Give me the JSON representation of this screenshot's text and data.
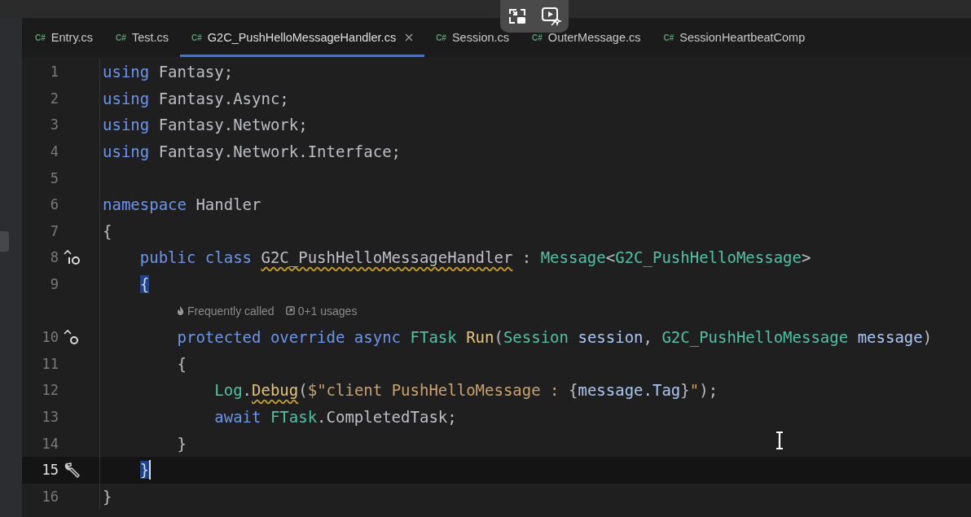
{
  "tabs": [
    {
      "badge": "C#",
      "label": "Entry.cs",
      "selected": false
    },
    {
      "badge": "C#",
      "label": "Test.cs",
      "selected": false
    },
    {
      "badge": "C#",
      "label": "G2C_PushHelloMessageHandler.cs",
      "selected": true
    },
    {
      "badge": "C#",
      "label": "Session.cs",
      "selected": false
    },
    {
      "badge": "C#",
      "label": "OuterMessage.cs",
      "selected": false
    },
    {
      "badge": "C#",
      "label": "SessionHeartbeatComp",
      "selected": false
    }
  ],
  "editor": {
    "rows": [
      {
        "kind": "code",
        "number": "1",
        "current": false,
        "tokens": [
          {
            "t": "using",
            "kind": "keyword"
          },
          {
            "t": " Fantasy;",
            "kind": "plain"
          }
        ]
      },
      {
        "kind": "code",
        "number": "2",
        "current": false,
        "tokens": [
          {
            "t": "using",
            "kind": "keyword"
          },
          {
            "t": " Fantasy.Async;",
            "kind": "plain"
          }
        ]
      },
      {
        "kind": "code",
        "number": "3",
        "current": false,
        "tokens": [
          {
            "t": "using",
            "kind": "keyword"
          },
          {
            "t": " Fantasy.Network;",
            "kind": "plain"
          }
        ]
      },
      {
        "kind": "code",
        "number": "4",
        "current": false,
        "tokens": [
          {
            "t": "using",
            "kind": "keyword"
          },
          {
            "t": " Fantasy.Network.Interface;",
            "kind": "plain"
          }
        ]
      },
      {
        "kind": "code",
        "number": "5",
        "current": false
      },
      {
        "kind": "code",
        "number": "6",
        "current": false,
        "tokens": [
          {
            "t": "namespace",
            "kind": "keyword"
          },
          {
            "t": " Handler",
            "kind": "plain"
          }
        ]
      },
      {
        "kind": "code",
        "number": "7",
        "current": false,
        "tokens": [
          {
            "t": "{",
            "kind": "plain"
          }
        ]
      },
      {
        "kind": "code",
        "number": "8",
        "current": false,
        "gutter_icon": {
          "kind": "implements"
        },
        "tokens": [
          {
            "t": "    public class ",
            "kind": "keyword"
          },
          {
            "t": "G2C_PushHelloMessageHandler",
            "kind": "warning"
          },
          {
            "t": " : ",
            "kind": "plain"
          },
          {
            "t": "Message",
            "kind": "type"
          },
          {
            "t": "<",
            "kind": "plain"
          },
          {
            "t": "G2C_PushHelloMessage",
            "kind": "type"
          },
          {
            "t": ">",
            "kind": "plain"
          }
        ]
      },
      {
        "kind": "code",
        "number": "9",
        "current": false,
        "indent": "    ",
        "tokens": [
          {
            "t": "{",
            "kind": "brace-match"
          }
        ]
      },
      {
        "kind": "hint",
        "items": [
          {
            "kind": "flame",
            "text": "Frequently called"
          },
          {
            "kind": "usages",
            "text": "0+1 usages"
          }
        ]
      },
      {
        "kind": "code",
        "number": "10",
        "current": false,
        "gutter_icon": {
          "kind": "overrides"
        },
        "tokens": [
          {
            "t": "        protected override async ",
            "kind": "keyword"
          },
          {
            "t": "FTask ",
            "kind": "type"
          },
          {
            "t": "Run",
            "kind": "method"
          },
          {
            "t": "(",
            "kind": "plain"
          },
          {
            "t": "Session ",
            "kind": "type"
          },
          {
            "t": "session",
            "kind": "param"
          },
          {
            "t": ", ",
            "kind": "plain"
          },
          {
            "t": "G2C_PushHelloMessage ",
            "kind": "type"
          },
          {
            "t": "message",
            "kind": "param"
          },
          {
            "t": ")",
            "kind": "plain"
          }
        ]
      },
      {
        "kind": "code",
        "number": "11",
        "current": false,
        "tokens": [
          {
            "t": "        {",
            "kind": "plain"
          }
        ]
      },
      {
        "kind": "code",
        "number": "12",
        "current": false,
        "tokens": [
          {
            "t": "            Log",
            "kind": "type"
          },
          {
            "t": ".",
            "kind": "plain"
          },
          {
            "t": "Debug",
            "kind": "method-warning"
          },
          {
            "t": "(",
            "kind": "plain"
          },
          {
            "t": "$\"client PushHelloMessage : ",
            "kind": "string"
          },
          {
            "t": "{",
            "kind": "plain"
          },
          {
            "t": "message.Tag",
            "kind": "param"
          },
          {
            "t": "}",
            "kind": "plain"
          },
          {
            "t": "\"",
            "kind": "string"
          },
          {
            "t": ");",
            "kind": "plain"
          }
        ]
      },
      {
        "kind": "code",
        "number": "13",
        "current": false,
        "tokens": [
          {
            "t": "            await ",
            "kind": "keyword"
          },
          {
            "t": "FTask",
            "kind": "type"
          },
          {
            "t": ".CompletedTask;",
            "kind": "plain"
          }
        ]
      },
      {
        "kind": "code",
        "number": "14",
        "current": false,
        "tokens": [
          {
            "t": "        }",
            "kind": "plain"
          }
        ]
      },
      {
        "kind": "code",
        "number": "15",
        "current": true,
        "gutter_icon": {
          "kind": "wrench"
        },
        "indent": "    ",
        "tokens": [
          {
            "t": "}",
            "kind": "brace-match"
          }
        ]
      },
      {
        "kind": "code",
        "number": "16",
        "current": false,
        "tokens": [
          {
            "t": "}",
            "kind": "plain"
          }
        ]
      }
    ]
  }
}
